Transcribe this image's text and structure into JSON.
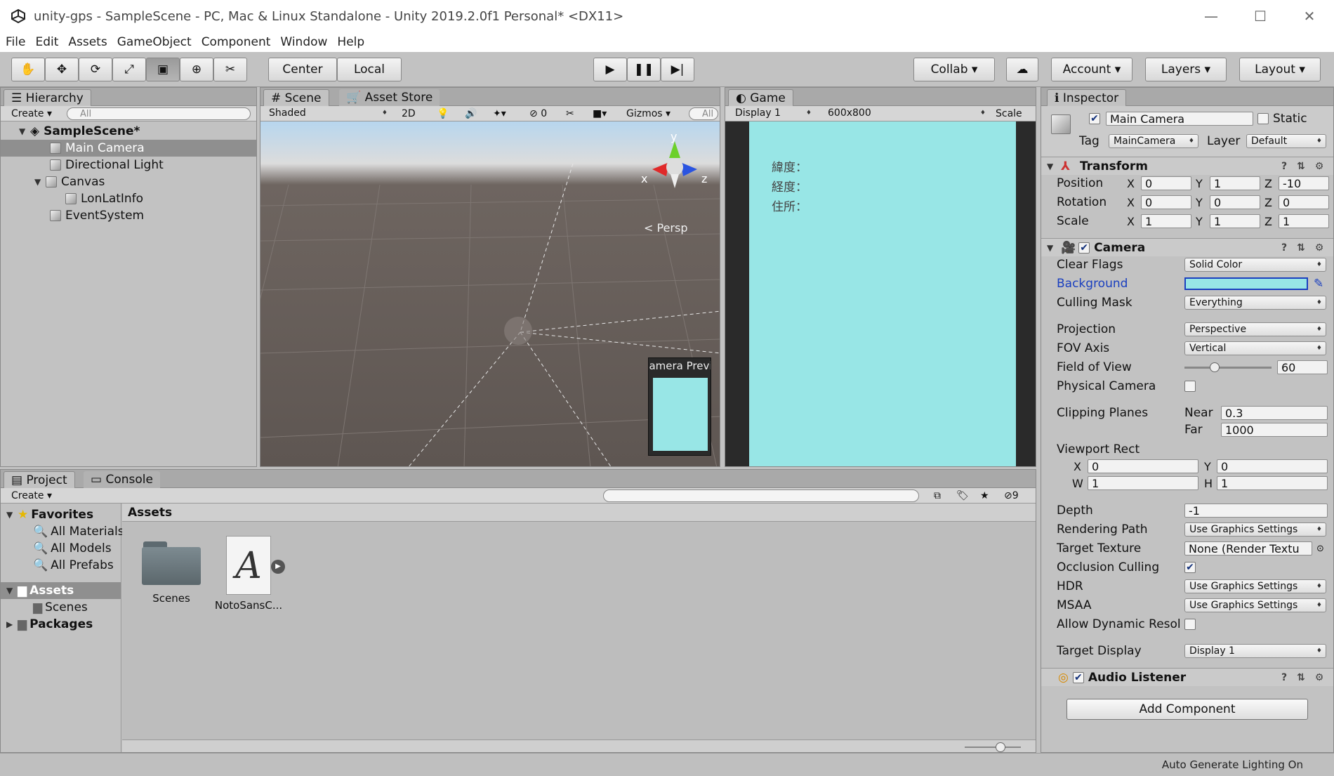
{
  "window": {
    "title": "unity-gps - SampleScene - PC, Mac & Linux Standalone - Unity 2019.2.0f1 Personal* <DX11>"
  },
  "menu": [
    "File",
    "Edit",
    "Assets",
    "GameObject",
    "Component",
    "Window",
    "Help"
  ],
  "toolbar": {
    "center": "Center",
    "local": "Local",
    "collab": "Collab ▾",
    "account": "Account",
    "layers": "Layers",
    "layout": "Layout"
  },
  "hierarchy": {
    "tab": "Hierarchy",
    "create": "Create",
    "search": "All",
    "scene": "SampleScene*",
    "items": [
      "Main Camera",
      "Directional Light",
      "Canvas",
      "LonLatInfo",
      "EventSystem"
    ]
  },
  "scene": {
    "tab": "Scene",
    "asset_tab": "Asset Store",
    "shading": "Shaded",
    "twoD": "2D",
    "hidden": "0",
    "gizmos": "Gizmos",
    "search": "All",
    "persp": "Persp",
    "axis_x": "x",
    "axis_y": "y",
    "axis_z": "z",
    "preview": "Camera Preview"
  },
  "game": {
    "tab": "Game",
    "display": "Display 1",
    "resolution": "600x800",
    "scale": "Scale",
    "lines": [
      "緯度：",
      "経度：",
      "住所："
    ]
  },
  "inspector": {
    "tab": "Inspector",
    "name": "Main Camera",
    "static": "Static",
    "tag_label": "Tag",
    "tag": "MainCamera",
    "layer_label": "Layer",
    "layer": "Default",
    "transform": {
      "title": "Transform",
      "position": "Position",
      "rotation": "Rotation",
      "scale": "Scale",
      "pos": [
        "0",
        "1",
        "-10"
      ],
      "rot": [
        "0",
        "0",
        "0"
      ],
      "scl": [
        "1",
        "1",
        "1"
      ]
    },
    "camera": {
      "title": "Camera",
      "clear_flags": "Clear Flags",
      "clear_flags_v": "Solid Color",
      "background": "Background",
      "culling": "Culling Mask",
      "culling_v": "Everything",
      "projection": "Projection",
      "projection_v": "Perspective",
      "fov_axis": "FOV Axis",
      "fov_axis_v": "Vertical",
      "fov": "Field of View",
      "fov_v": "60",
      "physical": "Physical Camera",
      "clipping": "Clipping Planes",
      "near": "Near",
      "near_v": "0.3",
      "far": "Far",
      "far_v": "1000",
      "viewport": "Viewport Rect",
      "vx": "0",
      "vy": "0",
      "vw": "1",
      "vh": "1",
      "depth": "Depth",
      "depth_v": "-1",
      "rendering": "Rendering Path",
      "rendering_v": "Use Graphics Settings",
      "target_tex": "Target Texture",
      "target_tex_v": "None (Render Textu",
      "occlusion": "Occlusion Culling",
      "hdr": "HDR",
      "hdr_v": "Use Graphics Settings",
      "msaa": "MSAA",
      "msaa_v": "Use Graphics Settings",
      "dyn": "Allow Dynamic Resol",
      "target_disp": "Target Display",
      "target_disp_v": "Display 1"
    },
    "audio": {
      "title": "Audio Listener"
    },
    "add": "Add Component"
  },
  "project": {
    "tab": "Project",
    "console": "Console",
    "create": "Create",
    "hidden_count": "9",
    "favorites": "Favorites",
    "fav_items": [
      "All Materials",
      "All Models",
      "All Prefabs"
    ],
    "assets": "Assets",
    "scenes": "Scenes",
    "packages": "Packages",
    "breadcrumb": "Assets",
    "files": [
      "Scenes",
      "NotoSansC..."
    ]
  },
  "status": "Auto Generate Lighting On",
  "colors": {
    "game_bg": "#98e6e6",
    "accent": "#1a3fbf"
  }
}
